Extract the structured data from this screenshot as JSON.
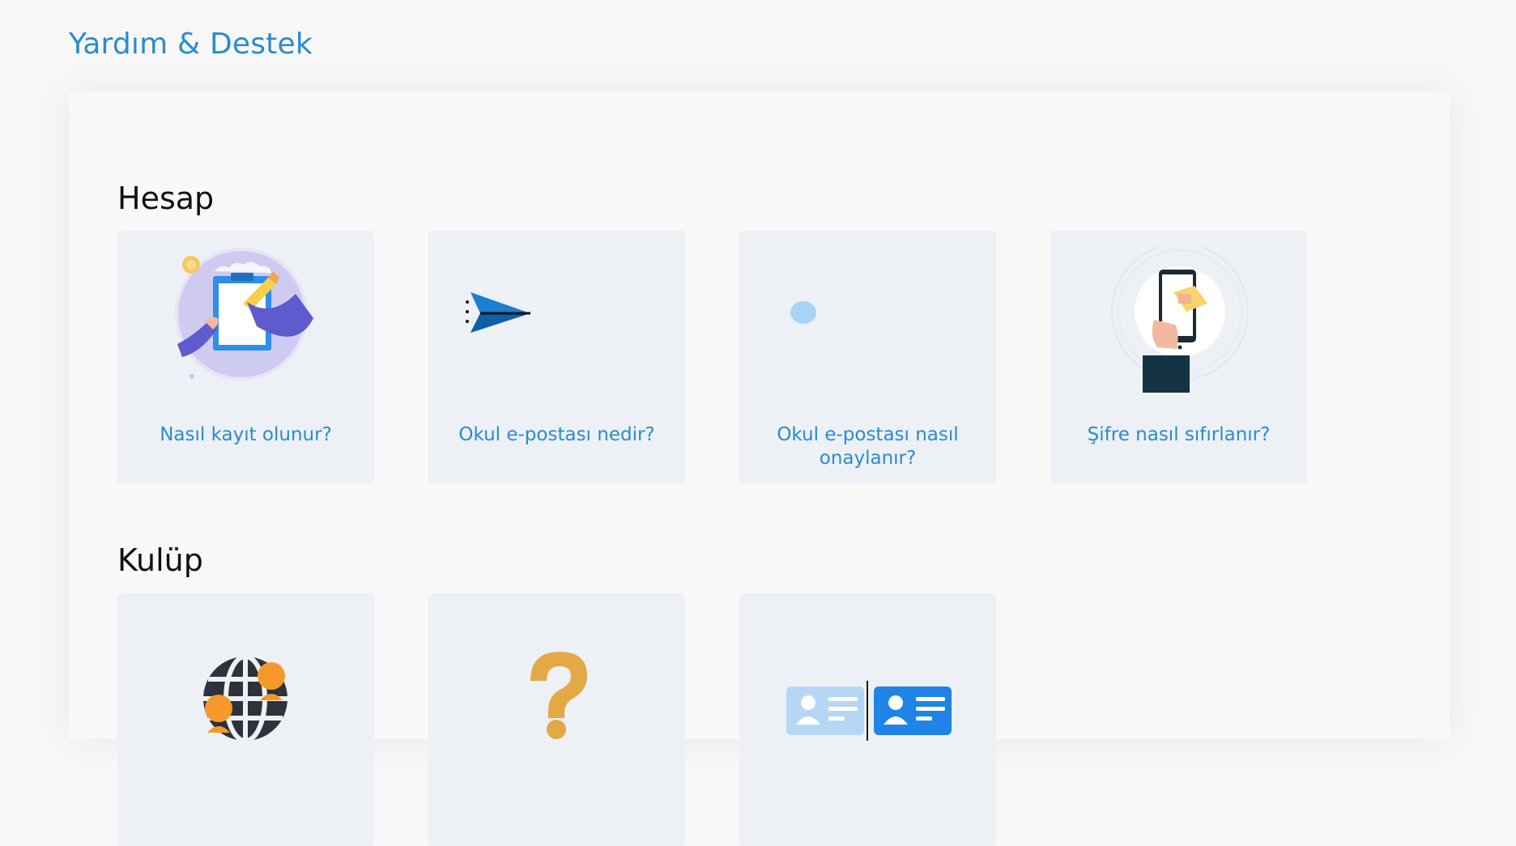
{
  "page": {
    "title": "Yardım & Destek"
  },
  "sections": [
    {
      "title": "Hesap",
      "cards": [
        {
          "label": "Nasıl kayıt olunur?",
          "icon": "registration-clipboard-illustration"
        },
        {
          "label": "Okul e-postası nedir?",
          "icon": "paper-plane-icon"
        },
        {
          "label": "Okul e-postası nasıl onaylanır?",
          "icon": "blue-dot-icon"
        },
        {
          "label": "Şifre nasıl sıfırlanır?",
          "icon": "phone-reset-illustration"
        }
      ]
    },
    {
      "title": "Kulüp",
      "cards": [
        {
          "label": "",
          "icon": "globe-people-icon"
        },
        {
          "label": "",
          "icon": "question-mark-icon"
        },
        {
          "label": "",
          "icon": "id-cards-icon"
        }
      ]
    }
  ],
  "colors": {
    "accent": "#2a8bd0",
    "card_bg": "#edf0f4",
    "page_bg": "#f7f7f7"
  }
}
